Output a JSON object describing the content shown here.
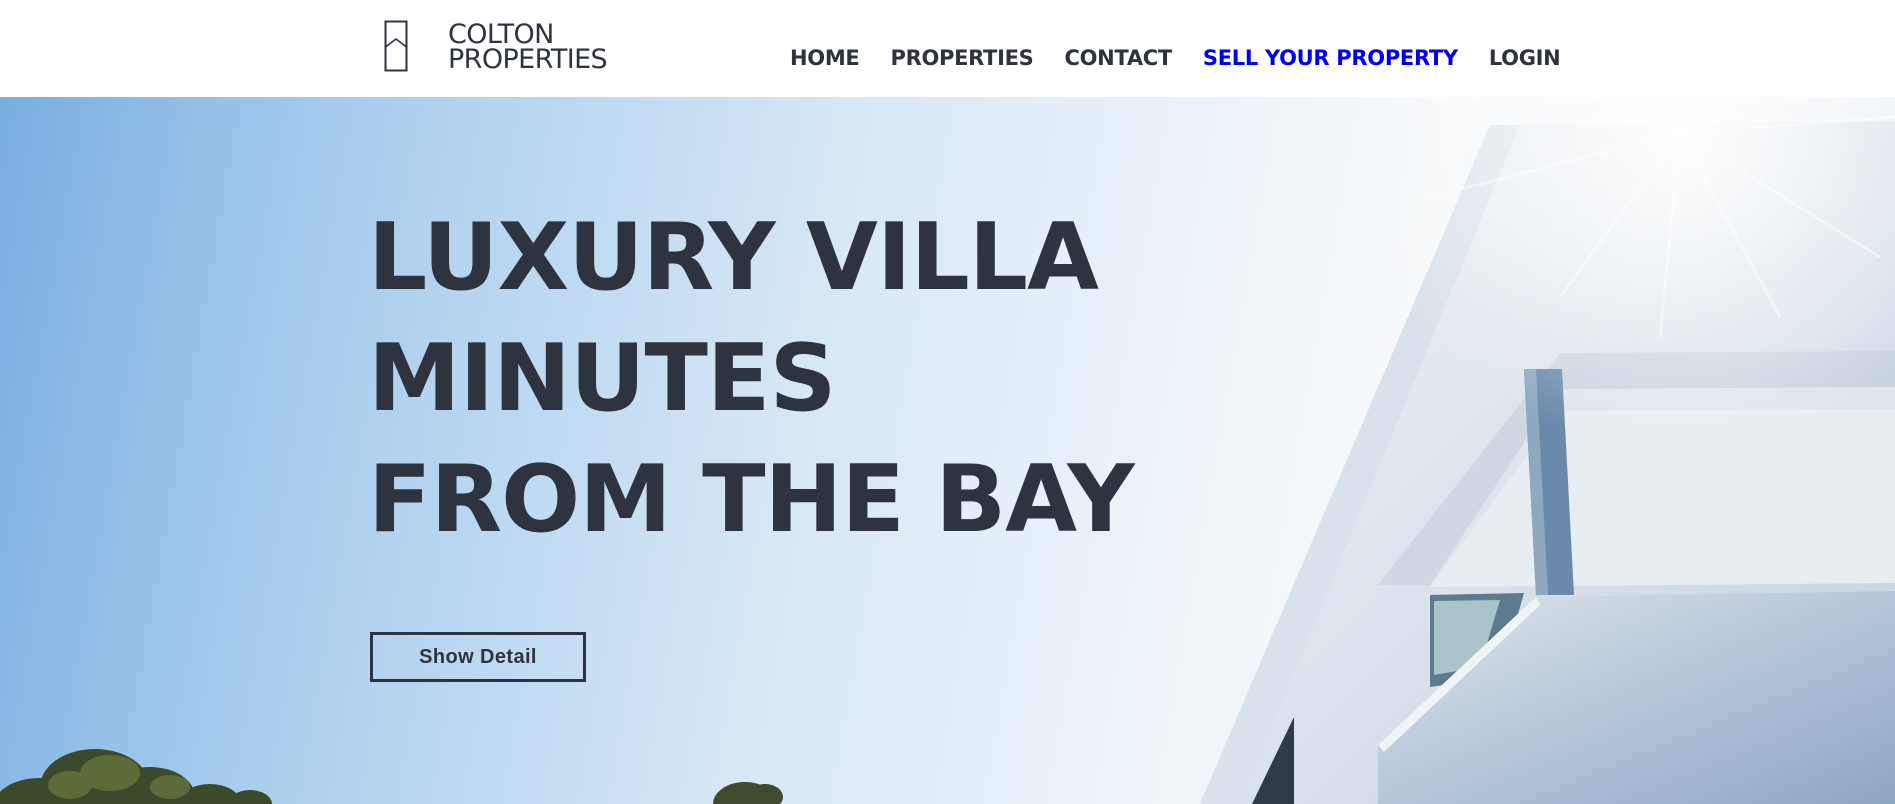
{
  "brand": {
    "line1": "COLTON",
    "line2": "PROPERTIES",
    "icon": "house-outline-logo"
  },
  "nav": {
    "items": [
      {
        "label": "HOME"
      },
      {
        "label": "PROPERTIES"
      },
      {
        "label": "CONTACT"
      },
      {
        "label": "SELL YOUR PROPERTY",
        "color": "#0000ee"
      },
      {
        "label": "LOGIN"
      }
    ]
  },
  "hero": {
    "headline": [
      "LUXURY VILLA",
      "MINUTES",
      "FROM THE BAY"
    ],
    "button_label": "Show Detail",
    "image": "modern-white-villa-against-blue-sky-with-sun-flare"
  },
  "colors": {
    "text_dark": "#2e3340",
    "accent_link": "#0000ee",
    "sky_light": "#e6f0f8",
    "sky_deep": "#78aee0"
  }
}
